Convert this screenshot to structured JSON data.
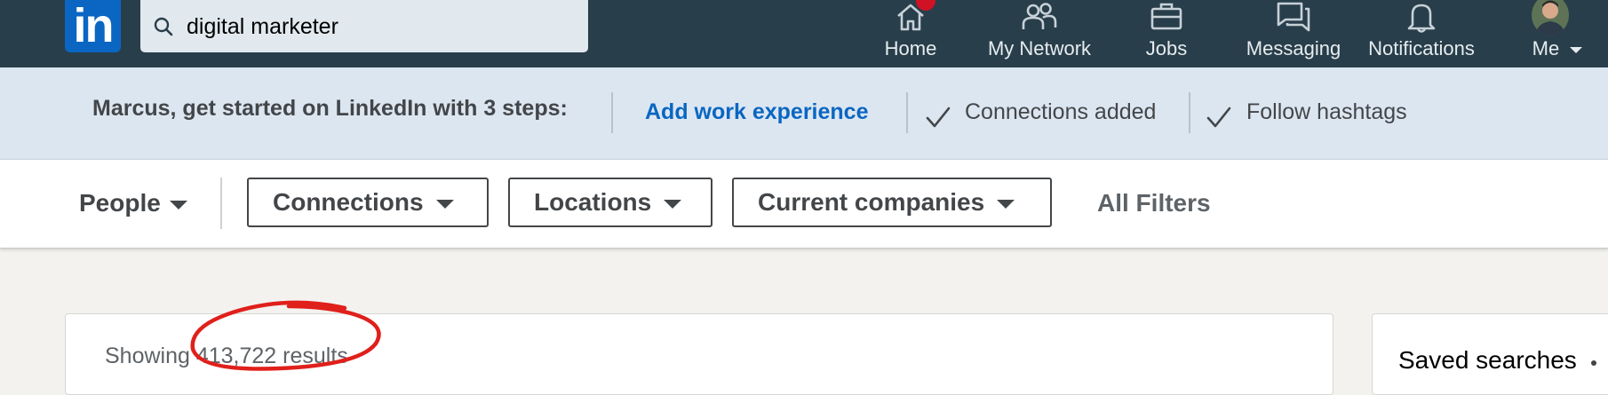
{
  "nav": {
    "search_value": "digital marketer",
    "items": [
      {
        "label": "Home",
        "icon": "home-icon"
      },
      {
        "label": "My Network",
        "icon": "network-icon"
      },
      {
        "label": "Jobs",
        "icon": "briefcase-icon"
      },
      {
        "label": "Messaging",
        "icon": "messaging-icon"
      },
      {
        "label": "Notifications",
        "icon": "bell-icon"
      },
      {
        "label": "Me",
        "icon": "avatar"
      }
    ],
    "logo_text": "in"
  },
  "onboarding": {
    "intro": "Marcus, get started on LinkedIn with 3 steps:",
    "steps": [
      {
        "label": "Add work experience",
        "done": false
      },
      {
        "label": "Connections added",
        "done": true
      },
      {
        "label": "Follow hashtags",
        "done": true
      }
    ]
  },
  "filters": {
    "type_label": "People",
    "buttons": [
      "Connections",
      "Locations",
      "Current companies"
    ],
    "all_filters": "All Filters"
  },
  "results": {
    "count_text": "Showing 413,722 results"
  },
  "sidebar": {
    "saved_searches": "Saved searches"
  },
  "colors": {
    "nav_bg": "#283e4a",
    "brand": "#0a66c2",
    "onboard_bg": "#dce6f1",
    "badge": "#d11124",
    "annotation": "#e0201b"
  }
}
